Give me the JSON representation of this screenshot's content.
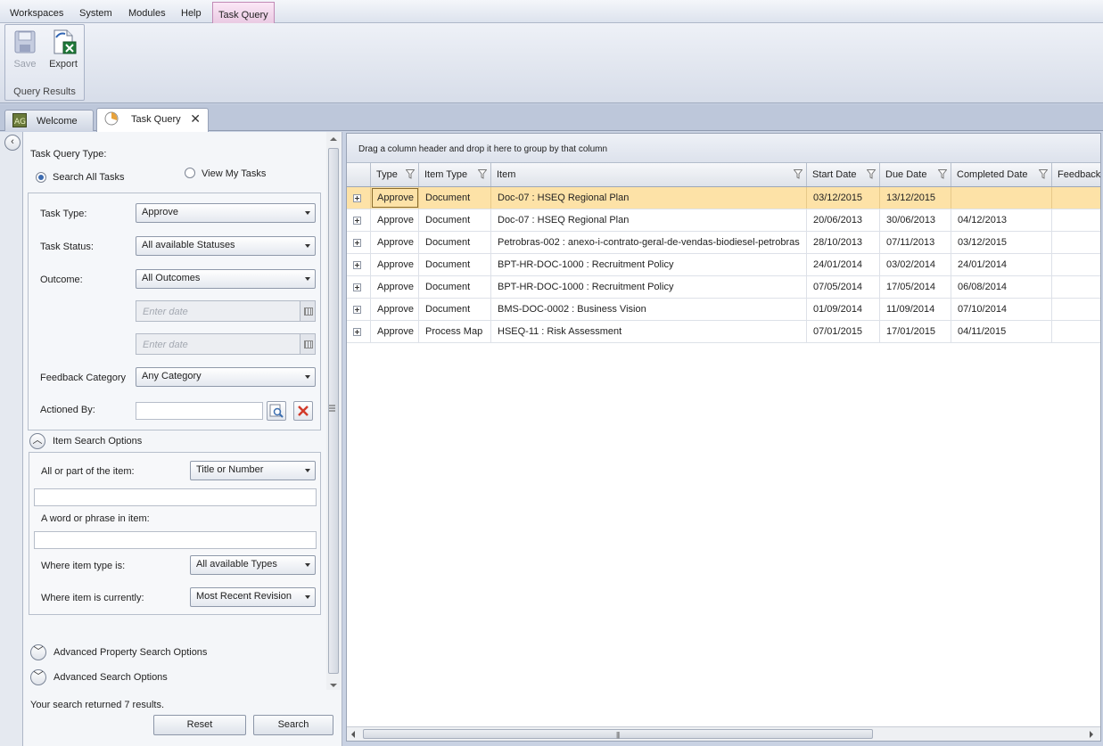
{
  "menu": {
    "items": [
      "Workspaces",
      "System",
      "Modules",
      "Help"
    ],
    "active_tab": "Task Query"
  },
  "ribbon": {
    "save_label": "Save",
    "export_label": "Export",
    "group_label": "Query Results"
  },
  "doc_tabs": [
    {
      "label": "Welcome",
      "icon": "ag-app-icon"
    },
    {
      "label": "Task Query",
      "icon": "task-query-icon",
      "active": true
    }
  ],
  "form": {
    "query_type_label": "Task Query Type:",
    "radio_all": "Search All Tasks",
    "radio_mine": "View My Tasks",
    "task_type_label": "Task Type:",
    "task_type_value": "Approve",
    "task_status_label": "Task Status:",
    "task_status_value": "All available Statuses",
    "outcome_label": "Outcome:",
    "outcome_value": "All Outcomes",
    "date_placeholder_1": "Enter date",
    "date_placeholder_2": "Enter date",
    "feedback_label": "Feedback Category",
    "feedback_value": "Any Category",
    "actioned_by_label": "Actioned By:",
    "item_search_header": "Item Search Options",
    "all_part_label": "All or part of the item:",
    "all_part_value": "Title or Number",
    "word_phrase_label": "A word or phrase in item:",
    "item_type_label": "Where item type is:",
    "item_type_value": "All available Types",
    "item_current_label": "Where item is currently:",
    "item_current_value": "Most Recent Revision",
    "adv_property_label": "Advanced Property Search Options",
    "adv_search_label": "Advanced Search Options",
    "result_text": "Your search returned 7 results.",
    "reset_label": "Reset",
    "search_label": "Search"
  },
  "grid": {
    "group_hint": "Drag a column header and drop it here to group by that column",
    "columns": [
      "Type",
      "Item Type",
      "Item",
      "Start Date",
      "Due Date",
      "Completed Date",
      "Feedback"
    ],
    "rows": [
      [
        "Approve",
        "Document",
        "Doc-07 : HSEQ Regional Plan",
        "03/12/2015",
        "13/12/2015",
        "",
        ""
      ],
      [
        "Approve",
        "Document",
        "Doc-07 : HSEQ Regional Plan",
        "20/06/2013",
        "30/06/2013",
        "04/12/2013",
        ""
      ],
      [
        "Approve",
        "Document",
        "Petrobras-002 : anexo-i-contrato-geral-de-vendas-biodiesel-petrobras",
        "28/10/2013",
        "07/11/2013",
        "03/12/2015",
        ""
      ],
      [
        "Approve",
        "Document",
        "BPT-HR-DOC-1000 : Recruitment Policy",
        "24/01/2014",
        "03/02/2014",
        "24/01/2014",
        ""
      ],
      [
        "Approve",
        "Document",
        "BPT-HR-DOC-1000 : Recruitment Policy",
        "07/05/2014",
        "17/05/2014",
        "06/08/2014",
        ""
      ],
      [
        "Approve",
        "Document",
        "BMS-DOC-0002 : Business Vision",
        "01/09/2014",
        "11/09/2014",
        "07/10/2014",
        ""
      ],
      [
        "Approve",
        "Process Map",
        "HSEQ-11 : Risk Assessment",
        "07/01/2015",
        "17/01/2015",
        "04/11/2015",
        ""
      ]
    ],
    "selected_row": 0
  },
  "colors": {
    "accent_tab": "#e9c9e2",
    "selected_row": "#fde2a7"
  }
}
